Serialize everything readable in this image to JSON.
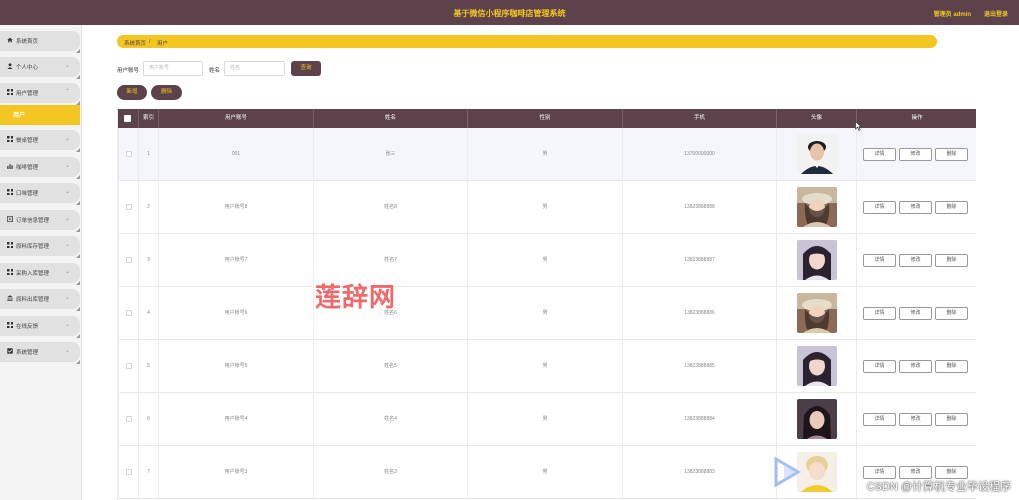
{
  "header": {
    "title": "基于微信小程序咖啡店管理系统",
    "admin": "管理员 admin",
    "logout": "退出登录"
  },
  "sidebar": {
    "items": [
      {
        "label": "系统首页",
        "icon": "home-icon",
        "arrow": false
      },
      {
        "label": "个人中心",
        "icon": "user-icon",
        "arrow": true
      },
      {
        "label": "用户管理",
        "icon": "grid-icon",
        "arrow": true
      },
      {
        "label": "餐桌管理",
        "icon": "grid-icon",
        "arrow": true
      },
      {
        "label": "咖啡管理",
        "icon": "bar-chart-icon",
        "arrow": true
      },
      {
        "label": "口味管理",
        "icon": "grid-icon",
        "arrow": true
      },
      {
        "label": "订单信息管理",
        "icon": "document-icon",
        "arrow": true
      },
      {
        "label": "原料库存管理",
        "icon": "grid-icon",
        "arrow": true
      },
      {
        "label": "采购入库管理",
        "icon": "grid-icon",
        "arrow": true
      },
      {
        "label": "原料出库管理",
        "icon": "bank-icon",
        "arrow": true
      },
      {
        "label": "在线反馈",
        "icon": "grid-icon",
        "arrow": true
      },
      {
        "label": "系统管理",
        "icon": "checkbox-icon",
        "arrow": true
      }
    ],
    "active_sub": "用户"
  },
  "breadcrumb": {
    "home": "系统首页",
    "sep": "/",
    "current": "用户"
  },
  "search": {
    "account_label": "用户账号",
    "account_placeholder": "用户账号",
    "name_label": "姓名",
    "name_placeholder": "姓名",
    "query_button": "查询"
  },
  "actions": {
    "add": "新增",
    "delete": "删除"
  },
  "table": {
    "columns": [
      "",
      "索引",
      "用户账号",
      "姓名",
      "性别",
      "手机",
      "头像",
      "操作"
    ],
    "row_buttons": {
      "detail": "详情",
      "edit": "修改",
      "delete": "删除"
    },
    "rows": [
      {
        "index": "1",
        "account": "001",
        "name": "张三",
        "gender": "男",
        "phone": "13700000000",
        "avatar": "male-portrait"
      },
      {
        "index": "2",
        "account": "用户账号8",
        "name": "姓名8",
        "gender": "男",
        "phone": "13823888888",
        "avatar": "female-hat-portrait"
      },
      {
        "index": "3",
        "account": "用户账号7",
        "name": "姓名7",
        "gender": "男",
        "phone": "13823888887",
        "avatar": "female-portrait"
      },
      {
        "index": "4",
        "account": "用户账号6",
        "name": "姓名6",
        "gender": "男",
        "phone": "13823888886",
        "avatar": "female-hat-portrait"
      },
      {
        "index": "5",
        "account": "用户账号5",
        "name": "姓名5",
        "gender": "男",
        "phone": "13823888885",
        "avatar": "female-portrait"
      },
      {
        "index": "6",
        "account": "用户账号4",
        "name": "姓名4",
        "gender": "男",
        "phone": "13823888884",
        "avatar": "female-portrait-dark"
      },
      {
        "index": "7",
        "account": "用户账号3",
        "name": "姓名3",
        "gender": "男",
        "phone": "13823888883",
        "avatar": "child-yellow-portrait"
      }
    ]
  },
  "watermarks": {
    "center": "莲辞网",
    "corner": "CSDN @计算机专业毕设程序"
  },
  "colors": {
    "brand": "#5c434b",
    "accent": "#f3c622"
  }
}
